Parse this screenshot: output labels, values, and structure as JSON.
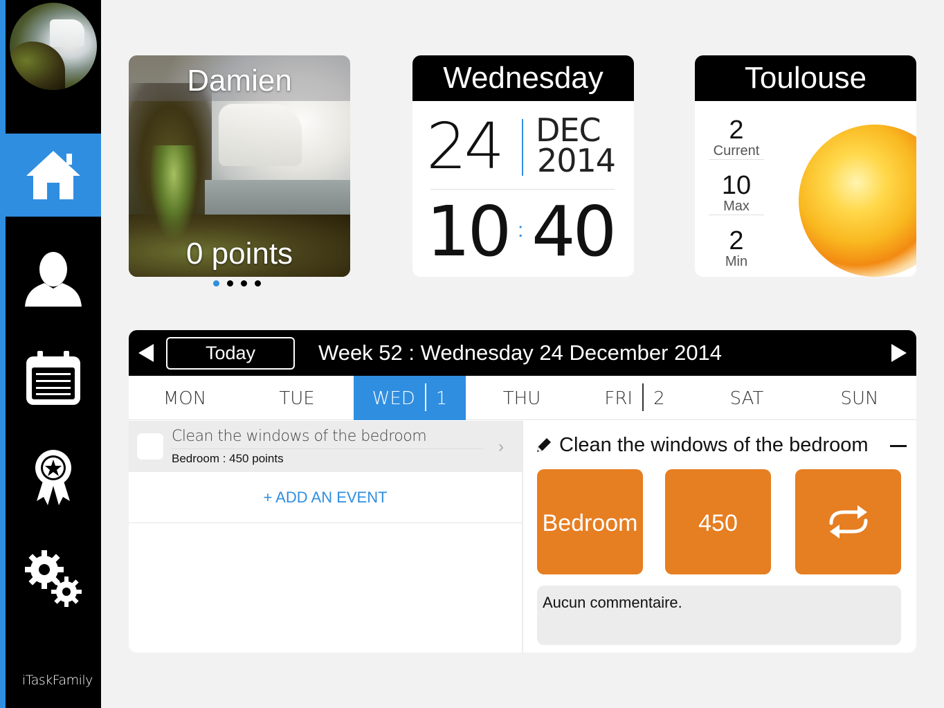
{
  "sidebar": {
    "nav": [
      {
        "name": "home",
        "icon": "home-icon",
        "active": true
      },
      {
        "name": "profile",
        "icon": "person-icon",
        "active": false
      },
      {
        "name": "calendar",
        "icon": "calendar-icon",
        "active": false
      },
      {
        "name": "rewards",
        "icon": "award-ribbon-icon",
        "active": false
      },
      {
        "name": "settings",
        "icon": "gears-icon",
        "active": false
      }
    ],
    "brand": "iTaskFamily"
  },
  "profile": {
    "name": "Damien",
    "points": "0 points",
    "page_dots": {
      "total": 4,
      "active": 1
    }
  },
  "date": {
    "weekday": "Wednesday",
    "day": "24",
    "month": "DEC",
    "year": "2014",
    "hour": "10",
    "minute": "40"
  },
  "weather": {
    "city": "Toulouse",
    "current_value": "2",
    "current_label": "Current",
    "max_value": "10",
    "max_label": "Max",
    "min_value": "2",
    "min_label": "Min",
    "icon": "sun-icon"
  },
  "calendar": {
    "today_label": "Today",
    "week_label": "Week 52 : Wednesday 24 December 2014",
    "days": [
      {
        "label": "MON",
        "count": ""
      },
      {
        "label": "TUE",
        "count": ""
      },
      {
        "label": "WED",
        "count": "1"
      },
      {
        "label": "THU",
        "count": ""
      },
      {
        "label": "FRI",
        "count": "2"
      },
      {
        "label": "SAT",
        "count": ""
      },
      {
        "label": "SUN",
        "count": ""
      }
    ],
    "active_day": "WED",
    "task": {
      "title": "Clean the windows of the bedroom",
      "subtitle": "Bedroom : 450 points"
    },
    "add_event_label": "+ ADD AN EVENT",
    "detail": {
      "title": "Clean the windows of the bedroom",
      "room": "Bedroom",
      "points": "450",
      "repeat_icon": "repeat-icon",
      "comment": "Aucun commentaire."
    }
  },
  "colors": {
    "accent": "#2f8ee0",
    "tile": "#e67e22",
    "sidebar": "#000000"
  }
}
